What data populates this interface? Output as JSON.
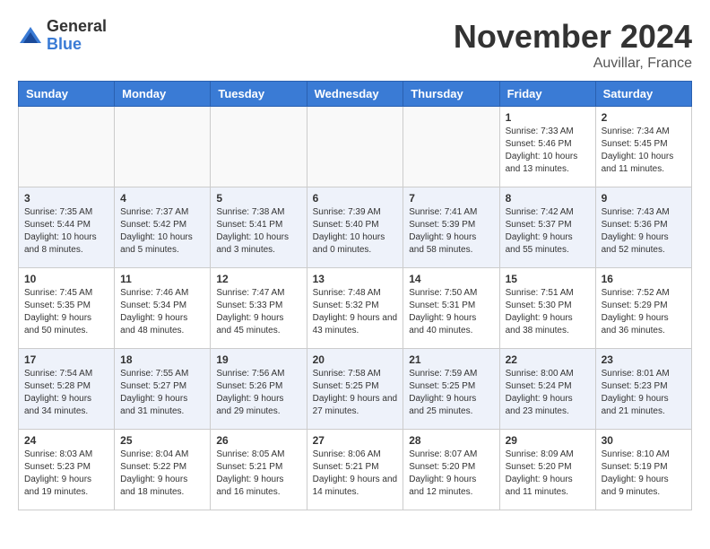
{
  "header": {
    "logo_general": "General",
    "logo_blue": "Blue",
    "month_title": "November 2024",
    "location": "Auvillar, France"
  },
  "weekdays": [
    "Sunday",
    "Monday",
    "Tuesday",
    "Wednesday",
    "Thursday",
    "Friday",
    "Saturday"
  ],
  "weeks": [
    [
      {
        "day": "",
        "info": ""
      },
      {
        "day": "",
        "info": ""
      },
      {
        "day": "",
        "info": ""
      },
      {
        "day": "",
        "info": ""
      },
      {
        "day": "",
        "info": ""
      },
      {
        "day": "1",
        "info": "Sunrise: 7:33 AM\nSunset: 5:46 PM\nDaylight: 10 hours and 13 minutes."
      },
      {
        "day": "2",
        "info": "Sunrise: 7:34 AM\nSunset: 5:45 PM\nDaylight: 10 hours and 11 minutes."
      }
    ],
    [
      {
        "day": "3",
        "info": "Sunrise: 7:35 AM\nSunset: 5:44 PM\nDaylight: 10 hours and 8 minutes."
      },
      {
        "day": "4",
        "info": "Sunrise: 7:37 AM\nSunset: 5:42 PM\nDaylight: 10 hours and 5 minutes."
      },
      {
        "day": "5",
        "info": "Sunrise: 7:38 AM\nSunset: 5:41 PM\nDaylight: 10 hours and 3 minutes."
      },
      {
        "day": "6",
        "info": "Sunrise: 7:39 AM\nSunset: 5:40 PM\nDaylight: 10 hours and 0 minutes."
      },
      {
        "day": "7",
        "info": "Sunrise: 7:41 AM\nSunset: 5:39 PM\nDaylight: 9 hours and 58 minutes."
      },
      {
        "day": "8",
        "info": "Sunrise: 7:42 AM\nSunset: 5:37 PM\nDaylight: 9 hours and 55 minutes."
      },
      {
        "day": "9",
        "info": "Sunrise: 7:43 AM\nSunset: 5:36 PM\nDaylight: 9 hours and 52 minutes."
      }
    ],
    [
      {
        "day": "10",
        "info": "Sunrise: 7:45 AM\nSunset: 5:35 PM\nDaylight: 9 hours and 50 minutes."
      },
      {
        "day": "11",
        "info": "Sunrise: 7:46 AM\nSunset: 5:34 PM\nDaylight: 9 hours and 48 minutes."
      },
      {
        "day": "12",
        "info": "Sunrise: 7:47 AM\nSunset: 5:33 PM\nDaylight: 9 hours and 45 minutes."
      },
      {
        "day": "13",
        "info": "Sunrise: 7:48 AM\nSunset: 5:32 PM\nDaylight: 9 hours and 43 minutes."
      },
      {
        "day": "14",
        "info": "Sunrise: 7:50 AM\nSunset: 5:31 PM\nDaylight: 9 hours and 40 minutes."
      },
      {
        "day": "15",
        "info": "Sunrise: 7:51 AM\nSunset: 5:30 PM\nDaylight: 9 hours and 38 minutes."
      },
      {
        "day": "16",
        "info": "Sunrise: 7:52 AM\nSunset: 5:29 PM\nDaylight: 9 hours and 36 minutes."
      }
    ],
    [
      {
        "day": "17",
        "info": "Sunrise: 7:54 AM\nSunset: 5:28 PM\nDaylight: 9 hours and 34 minutes."
      },
      {
        "day": "18",
        "info": "Sunrise: 7:55 AM\nSunset: 5:27 PM\nDaylight: 9 hours and 31 minutes."
      },
      {
        "day": "19",
        "info": "Sunrise: 7:56 AM\nSunset: 5:26 PM\nDaylight: 9 hours and 29 minutes."
      },
      {
        "day": "20",
        "info": "Sunrise: 7:58 AM\nSunset: 5:25 PM\nDaylight: 9 hours and 27 minutes."
      },
      {
        "day": "21",
        "info": "Sunrise: 7:59 AM\nSunset: 5:25 PM\nDaylight: 9 hours and 25 minutes."
      },
      {
        "day": "22",
        "info": "Sunrise: 8:00 AM\nSunset: 5:24 PM\nDaylight: 9 hours and 23 minutes."
      },
      {
        "day": "23",
        "info": "Sunrise: 8:01 AM\nSunset: 5:23 PM\nDaylight: 9 hours and 21 minutes."
      }
    ],
    [
      {
        "day": "24",
        "info": "Sunrise: 8:03 AM\nSunset: 5:23 PM\nDaylight: 9 hours and 19 minutes."
      },
      {
        "day": "25",
        "info": "Sunrise: 8:04 AM\nSunset: 5:22 PM\nDaylight: 9 hours and 18 minutes."
      },
      {
        "day": "26",
        "info": "Sunrise: 8:05 AM\nSunset: 5:21 PM\nDaylight: 9 hours and 16 minutes."
      },
      {
        "day": "27",
        "info": "Sunrise: 8:06 AM\nSunset: 5:21 PM\nDaylight: 9 hours and 14 minutes."
      },
      {
        "day": "28",
        "info": "Sunrise: 8:07 AM\nSunset: 5:20 PM\nDaylight: 9 hours and 12 minutes."
      },
      {
        "day": "29",
        "info": "Sunrise: 8:09 AM\nSunset: 5:20 PM\nDaylight: 9 hours and 11 minutes."
      },
      {
        "day": "30",
        "info": "Sunrise: 8:10 AM\nSunset: 5:19 PM\nDaylight: 9 hours and 9 minutes."
      }
    ]
  ]
}
